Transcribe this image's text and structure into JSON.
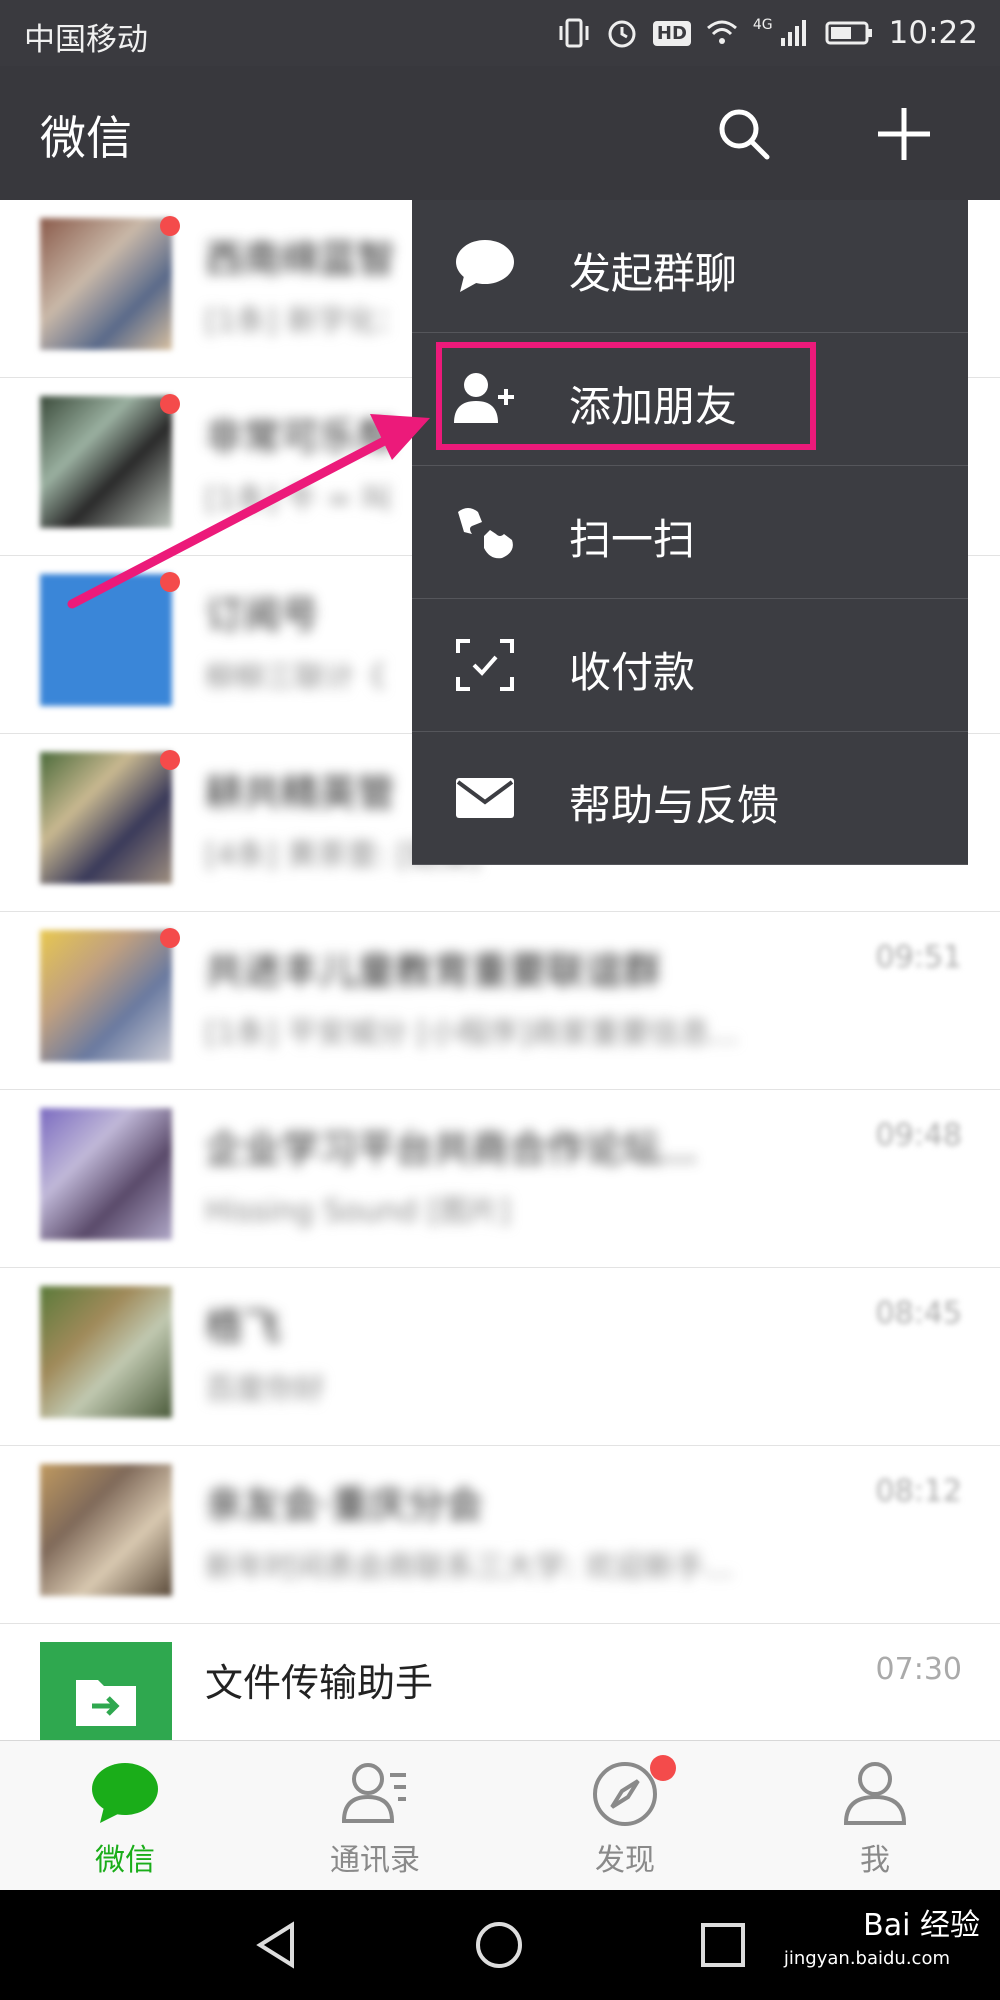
{
  "status_bar": {
    "carrier": "中国移动",
    "network": "4G",
    "hd": "HD",
    "time": "10:22"
  },
  "header": {
    "title": "微信"
  },
  "chats": [
    {
      "name": "西南绵蓝智",
      "preview": "[1条] 新字化：",
      "time": "",
      "badge": true,
      "blurred": true
    },
    {
      "name": "非常可乐帮",
      "preview": "[1条] 牛 = 叫",
      "time": "",
      "badge": true,
      "blurred": true
    },
    {
      "name": "订阅号",
      "preview": "柳柳三联计《",
      "time": "",
      "badge": true,
      "blurred": true
    },
    {
      "name": "耕共精英管",
      "preview": "[4条] 黄茶壹: [链接]",
      "time": "",
      "badge": true,
      "blurred": true
    },
    {
      "name": "共进丰儿童教育重要联谊群",
      "preview": "[1条] 平安城分 [小程序]商家重要信息...",
      "time": "09:51",
      "badge": true,
      "blurred": true
    },
    {
      "name": "企业学习平台共商合作论坛...",
      "preview": "Hissing Sound [图片]",
      "time": "09:48",
      "badge": false,
      "blurred": true
    },
    {
      "name": "梧飞",
      "preview": "百度你好",
      "time": "08:45",
      "badge": false,
      "blurred": true
    },
    {
      "name": "亲友会·重庆分会",
      "preview": "新年时间表会商联系三大学: 欢迎新手...",
      "time": "08:12",
      "badge": false,
      "blurred": true
    },
    {
      "name": "文件传输助手",
      "preview": "",
      "time": "07:30",
      "badge": false,
      "blurred": false
    }
  ],
  "menu": {
    "items": [
      {
        "label": "发起群聊",
        "icon": "chat-bubble-icon"
      },
      {
        "label": "添加朋友",
        "icon": "add-friend-icon"
      },
      {
        "label": "扫一扫",
        "icon": "scan-icon"
      },
      {
        "label": "收付款",
        "icon": "payment-icon"
      },
      {
        "label": "帮助与反馈",
        "icon": "mail-icon"
      }
    ],
    "highlight_color": "#ec1a7a"
  },
  "tabs": [
    {
      "label": "微信",
      "active": true
    },
    {
      "label": "通讯录",
      "active": false
    },
    {
      "label": "发现",
      "active": false,
      "badge": true
    },
    {
      "label": "我",
      "active": false
    }
  ],
  "watermark": {
    "logo_text": "Bai 经验",
    "url": "jingyan.baidu.com"
  },
  "colors": {
    "accent": "#1aad19",
    "header": "#38383d",
    "menu": "#3c3d42",
    "badge": "#f44b4b"
  }
}
